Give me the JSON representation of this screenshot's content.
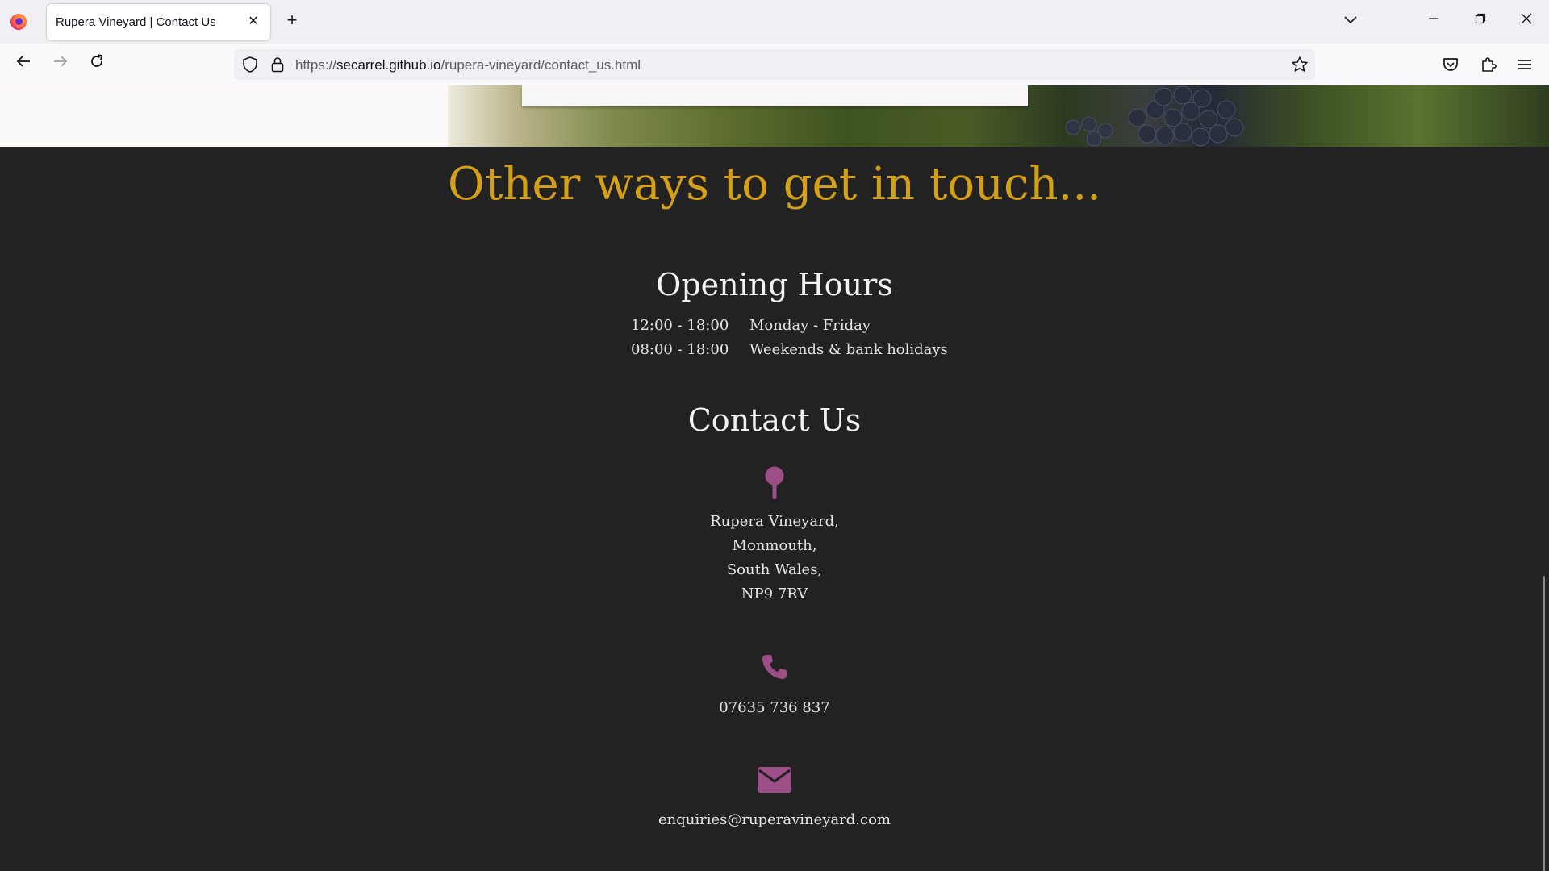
{
  "browser": {
    "tab_title": "Rupera Vineyard | Contact Us",
    "url_prefix": "https://",
    "url_host": "secarrel.github.io",
    "url_path": "/rupera-vineyard/contact_us.html"
  },
  "page": {
    "other_ways_title": "Other ways to get in touch...",
    "opening_hours": {
      "heading": "Opening Hours",
      "rows": [
        {
          "time": "12:00 - 18:00",
          "days": "Monday - Friday"
        },
        {
          "time": "08:00 - 18:00",
          "days": "Weekends & bank holidays"
        }
      ]
    },
    "contact": {
      "heading": "Contact Us",
      "address_lines": [
        "Rupera Vineyard,",
        "Monmouth,",
        "South Wales,",
        "NP9 7RV"
      ],
      "phone": "07635 736 837",
      "email": "enquiries@ruperavineyard.com"
    }
  },
  "colors": {
    "accent_gold": "#d4a017",
    "icon_purple": "#9b4f86",
    "background": "#222222"
  },
  "icons": [
    "map-pin-icon",
    "phone-icon",
    "envelope-icon"
  ]
}
